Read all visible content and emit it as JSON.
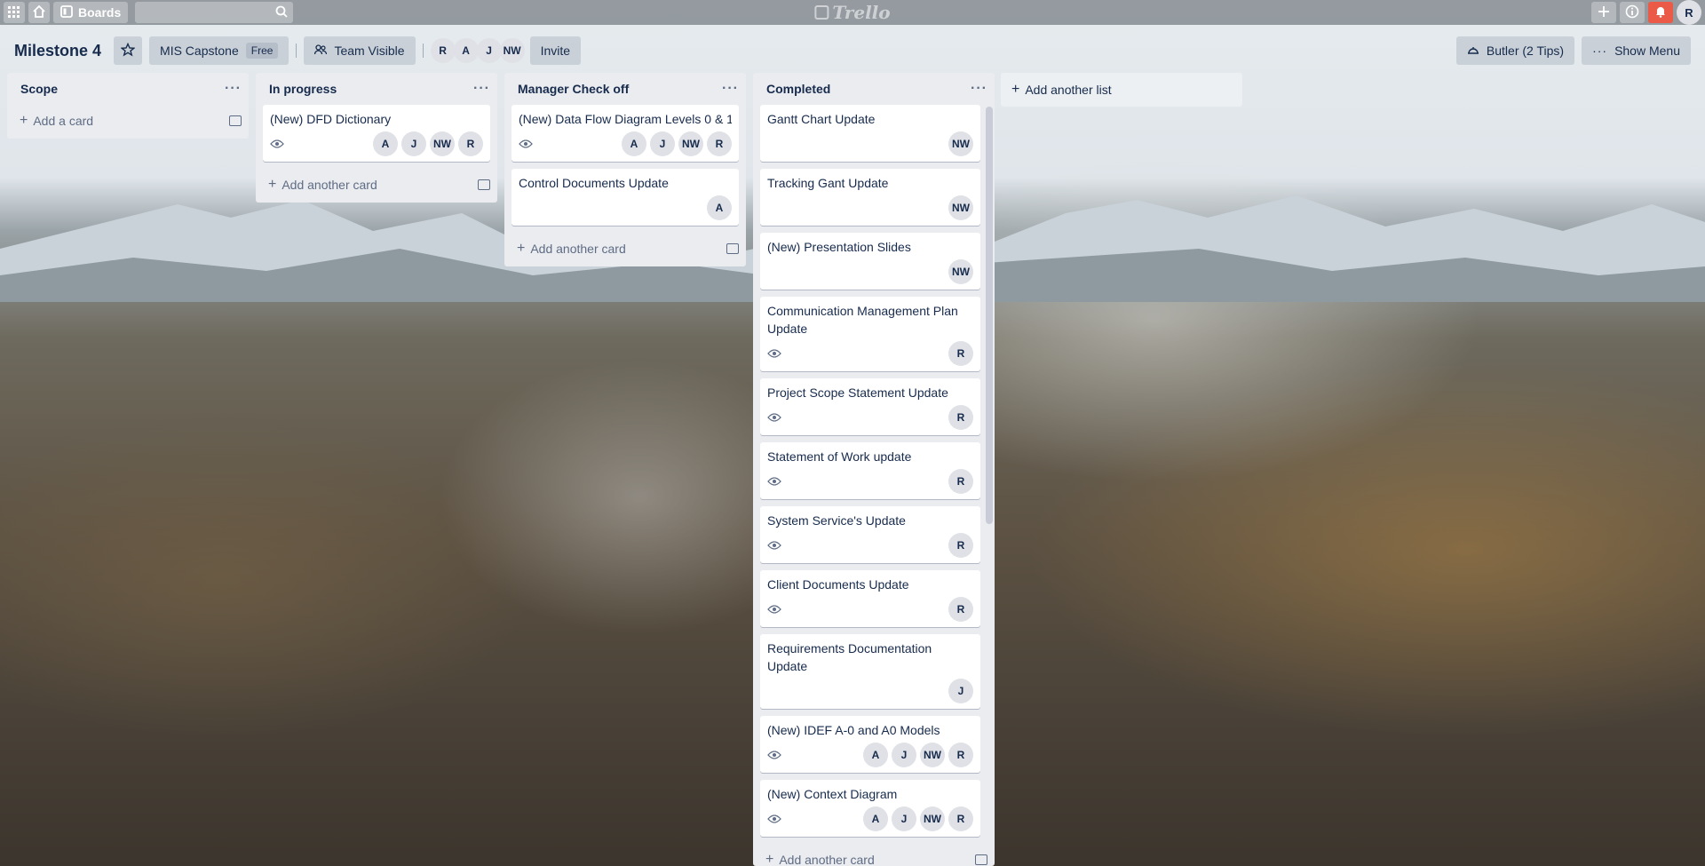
{
  "topbar": {
    "boards_label": "Boards",
    "logo_text": "Trello",
    "user_initial": "R",
    "icons": [
      "apps-grid-icon",
      "home-icon",
      "board-icon",
      "search-icon",
      "plus-icon",
      "info-icon",
      "bell-icon"
    ]
  },
  "board": {
    "title": "Milestone 4",
    "team_name": "MIS Capstone",
    "team_badge": "Free",
    "visibility": "Team Visible",
    "members": [
      "R",
      "A",
      "J",
      "NW"
    ],
    "invite_label": "Invite",
    "butler_label": "Butler (2 Tips)",
    "show_menu_label": "Show Menu",
    "add_list_label": "Add another list"
  },
  "lists": [
    {
      "title": "Scope",
      "add_label": "Add a card",
      "cards": []
    },
    {
      "title": "In progress",
      "add_label": "Add another card",
      "cards": [
        {
          "title": "(New) DFD Dictionary",
          "watched": true,
          "members": [
            "A",
            "J",
            "NW",
            "R"
          ]
        }
      ]
    },
    {
      "title": "Manager Check off",
      "add_label": "Add another card",
      "cards": [
        {
          "title": "(New) Data Flow Diagram Levels 0 & 1,",
          "watched": true,
          "members": [
            "A",
            "J",
            "NW",
            "R"
          ]
        },
        {
          "title": "Control Documents Update",
          "watched": false,
          "members": [
            "A"
          ]
        }
      ]
    },
    {
      "title": "Completed",
      "add_label": "Add another card",
      "cards": [
        {
          "title": "Gantt Chart Update",
          "watched": false,
          "members": [
            "NW"
          ]
        },
        {
          "title": "Tracking Gant Update",
          "watched": false,
          "members": [
            "NW"
          ]
        },
        {
          "title": "(New) Presentation Slides",
          "watched": false,
          "members": [
            "NW"
          ]
        },
        {
          "title": "Communication Management Plan Update",
          "watched": true,
          "members": [
            "R"
          ]
        },
        {
          "title": "Project Scope Statement Update",
          "watched": true,
          "members": [
            "R"
          ]
        },
        {
          "title": "Statement of Work update",
          "watched": true,
          "members": [
            "R"
          ]
        },
        {
          "title": "System Service's Update",
          "watched": true,
          "members": [
            "R"
          ]
        },
        {
          "title": "Client Documents Update",
          "watched": true,
          "members": [
            "R"
          ]
        },
        {
          "title": "Requirements Documentation Update",
          "watched": false,
          "members": [
            "J"
          ]
        },
        {
          "title": "(New) IDEF A-0 and A0 Models",
          "watched": true,
          "members": [
            "A",
            "J",
            "NW",
            "R"
          ]
        },
        {
          "title": "(New) Context Diagram",
          "watched": true,
          "members": [
            "A",
            "J",
            "NW",
            "R"
          ]
        }
      ]
    }
  ]
}
